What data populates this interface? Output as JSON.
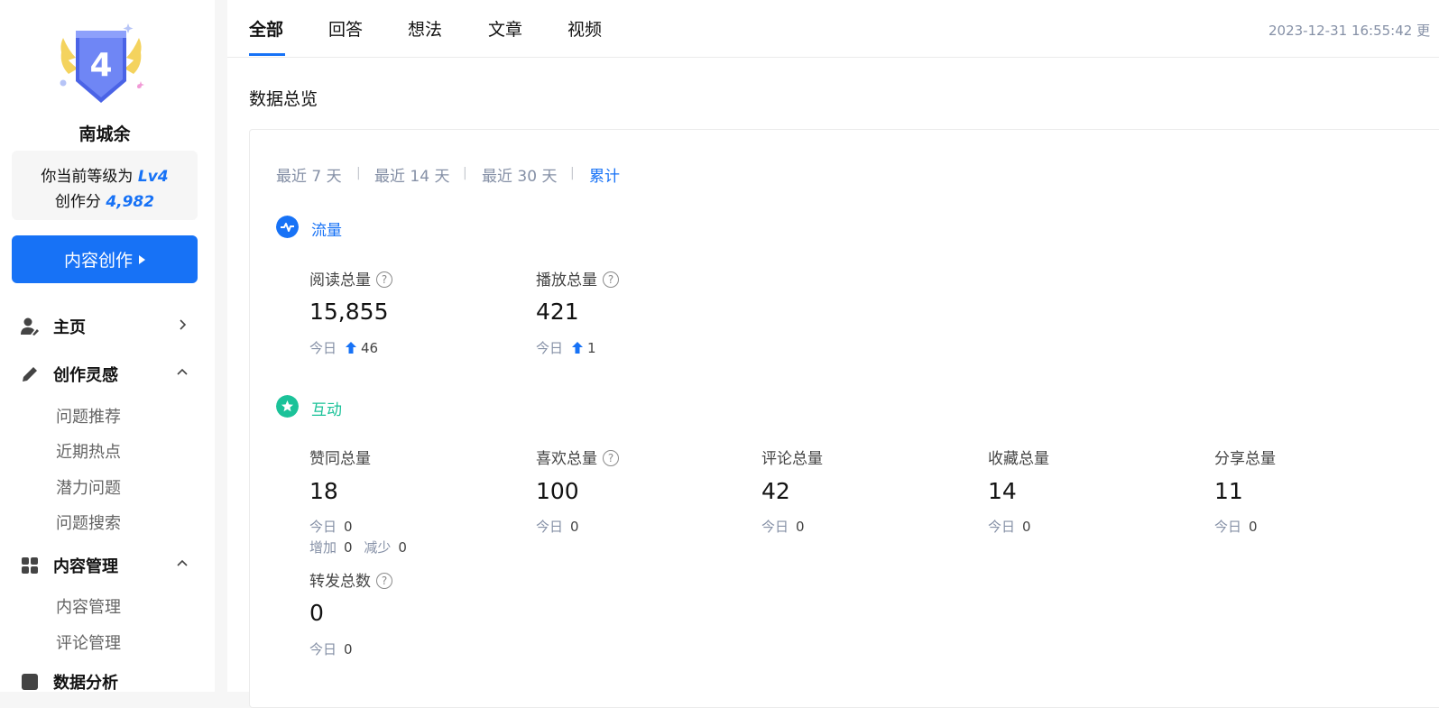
{
  "sidebar": {
    "badge_level": "4",
    "username": "南城余",
    "level_prefix": "你当前等级为",
    "level_value": "Lv4",
    "score_prefix": "创作分",
    "score_value": "4,982",
    "create_button": "内容创作",
    "groups": [
      {
        "label": "主页",
        "icon": "user-icon",
        "chevron": "chevron-right-icon"
      },
      {
        "label": "创作灵感",
        "icon": "pencil-icon",
        "chevron": "chevron-up-icon",
        "items": [
          "问题推荐",
          "近期热点",
          "潜力问题",
          "问题搜索"
        ]
      },
      {
        "label": "内容管理",
        "icon": "grid-icon",
        "chevron": "chevron-up-icon",
        "items": [
          "内容管理",
          "评论管理"
        ]
      },
      {
        "label": "数据分析",
        "icon": "chart-icon"
      }
    ]
  },
  "tabs": [
    "全部",
    "回答",
    "想法",
    "文章",
    "视频"
  ],
  "active_tab": 0,
  "updated_text": "2023-12-31 16:55:42 更",
  "section_title": "数据总览",
  "ranges": [
    "最近 7 天",
    "最近 14 天",
    "最近 30 天",
    "累计"
  ],
  "active_range": 3,
  "colors": {
    "accent": "#1772f6",
    "traffic": "#1772f6",
    "interaction": "#1bc299"
  },
  "traffic": {
    "label": "流量",
    "metrics": [
      {
        "label": "阅读总量",
        "value": "15,855",
        "today_label": "今日",
        "today_value": "46"
      },
      {
        "label": "播放总量",
        "value": "421",
        "today_label": "今日",
        "today_value": "1"
      }
    ]
  },
  "interaction": {
    "label": "互动",
    "metrics": [
      {
        "label": "赞同总量",
        "value": "18",
        "today_label": "今日",
        "today_value": "0",
        "inc_label": "增加",
        "inc_value": "0",
        "dec_label": "减少",
        "dec_value": "0"
      },
      {
        "label": "喜欢总量",
        "value": "100",
        "today_label": "今日",
        "today_value": "0"
      },
      {
        "label": "评论总量",
        "value": "42",
        "today_label": "今日",
        "today_value": "0"
      },
      {
        "label": "收藏总量",
        "value": "14",
        "today_label": "今日",
        "today_value": "0"
      },
      {
        "label": "分享总量",
        "value": "11",
        "today_label": "今日",
        "today_value": "0"
      },
      {
        "label": "转发总数",
        "value": "0",
        "today_label": "今日",
        "today_value": "0"
      }
    ]
  }
}
